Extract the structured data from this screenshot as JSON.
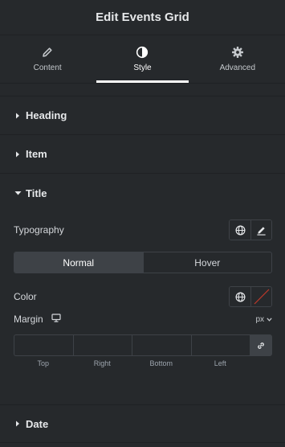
{
  "header": {
    "title": "Edit Events Grid"
  },
  "tabs": [
    {
      "label": "Content",
      "icon": "pencil-icon"
    },
    {
      "label": "Style",
      "icon": "half-circle-icon",
      "active": true
    },
    {
      "label": "Advanced",
      "icon": "gear-icon"
    }
  ],
  "sections": {
    "heading": "Heading",
    "item": "Item",
    "title": "Title",
    "date": "Date"
  },
  "title_panel": {
    "typography_label": "Typography",
    "state_toggle": {
      "normal": "Normal",
      "hover": "Hover",
      "active": "Normal"
    },
    "color_label": "Color",
    "margin_label": "Margin",
    "margin_unit": "px",
    "margin_fields": {
      "top": {
        "value": "",
        "label": "Top"
      },
      "right": {
        "value": "",
        "label": "Right"
      },
      "bottom": {
        "value": "",
        "label": "Bottom"
      },
      "left": {
        "value": "",
        "label": "Left"
      }
    }
  },
  "colors": {
    "background": "#26292c",
    "border": "#3e4247",
    "accent_active": "#ffffff",
    "clear_swatch_line": "#c0392b"
  }
}
